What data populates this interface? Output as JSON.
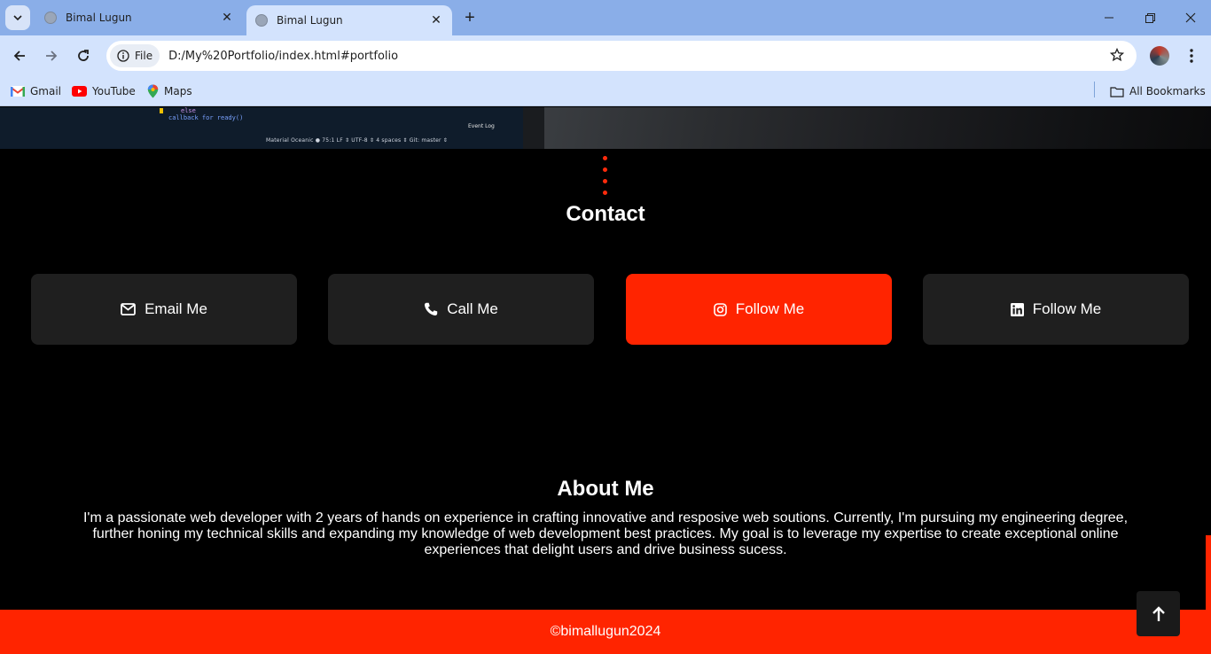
{
  "browser": {
    "tabs": [
      {
        "title": "Bimal Lugun",
        "active": false
      },
      {
        "title": "Bimal Lugun",
        "active": true
      }
    ],
    "address": {
      "chip": "File",
      "url": "D:/My%20Portfolio/index.html#portfolio"
    },
    "bookmarks": [
      {
        "label": "Gmail",
        "icon": "gmail-icon"
      },
      {
        "label": "YouTube",
        "icon": "youtube-icon"
      },
      {
        "label": "Maps",
        "icon": "maps-icon"
      }
    ],
    "all_bookmarks": "All Bookmarks"
  },
  "hero": {
    "code_line_1": "else",
    "code_line_2": "callback for ready()",
    "event_log": "Event Log",
    "status": "Material Oceanic ● 75:1  LF ⇕  UTF-8 ⇕  4 spaces ⇕  Git: master ⇕"
  },
  "contact": {
    "title": "Contact",
    "cards": [
      {
        "label": "Email Me",
        "icon": "envelope-icon",
        "active": false
      },
      {
        "label": "Call Me",
        "icon": "phone-icon",
        "active": false
      },
      {
        "label": "Follow Me",
        "icon": "instagram-icon",
        "active": true
      },
      {
        "label": "Follow Me",
        "icon": "linkedin-icon",
        "active": false
      }
    ]
  },
  "about": {
    "title": "About Me",
    "text": "I'm a passionate web developer with 2 years of hands on experience in crafting innovative and resposive web soutions. Currently, I'm pursuing my engineering degree, further honing my technical skills and expanding my knowledge of web development best practices. My goal is to leverage my expertise to create exceptional online experiences that delight users and drive business sucess."
  },
  "footer": {
    "text": "©bimallugun2024"
  },
  "colors": {
    "accent": "#ff2400",
    "card": "#1f1f1f",
    "background": "#000000"
  }
}
